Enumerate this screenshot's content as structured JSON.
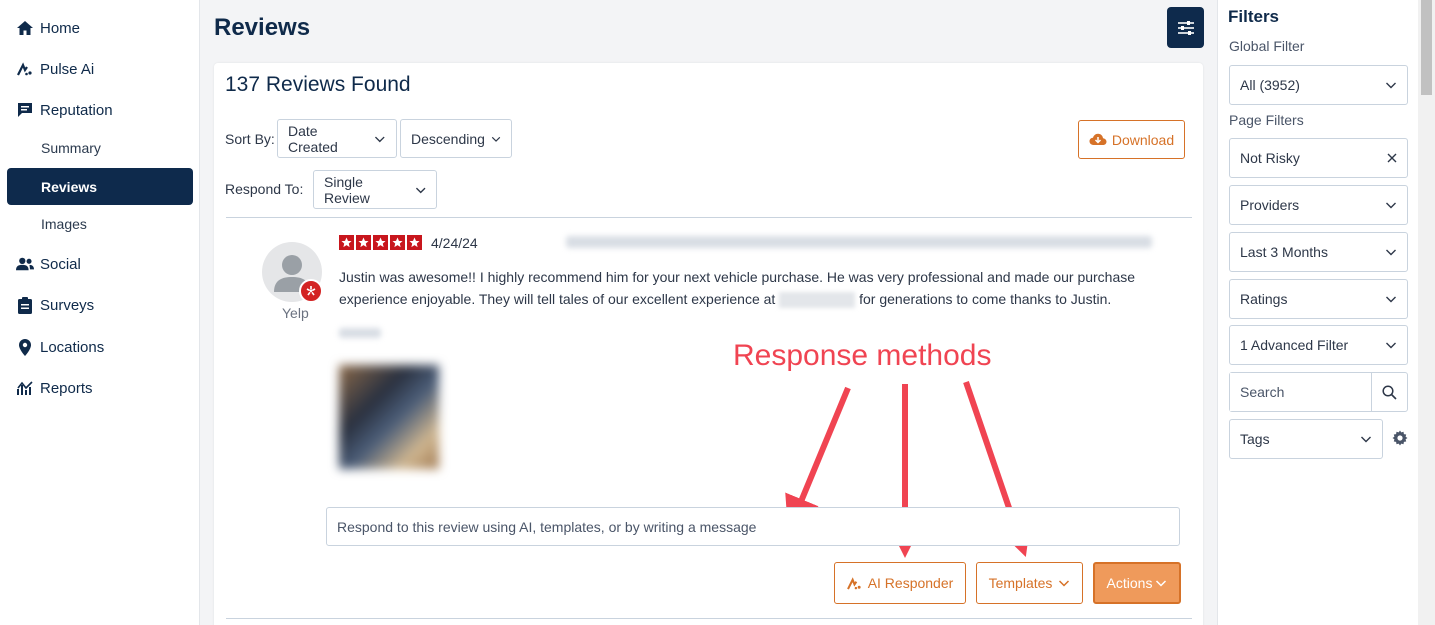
{
  "nav": {
    "home": "Home",
    "pulse_ai": "Pulse Ai",
    "reputation": "Reputation",
    "summary": "Summary",
    "reviews": "Reviews",
    "images": "Images",
    "social": "Social",
    "surveys": "Surveys",
    "locations": "Locations",
    "reports": "Reports"
  },
  "header": {
    "title": "Reviews"
  },
  "results": {
    "count_text": "137 Reviews Found"
  },
  "controls": {
    "sort_by_label": "Sort By:",
    "sort_field": "Date Created",
    "sort_order": "Descending",
    "respond_to_label": "Respond To:",
    "respond_to_value": "Single Review",
    "download_label": "Download"
  },
  "review": {
    "source": "Yelp",
    "rating": 5,
    "date": "4/24/24",
    "text_part1": "Justin was awesome!! I highly recommend him for your next vehicle purchase. He was very professional and made our purchase experience enjoyable. They will tell tales of our excellent experience at",
    "text_part2": "for generations to come thanks to Justin."
  },
  "annotation": {
    "text": "Response methods"
  },
  "response": {
    "placeholder": "Respond to this review using AI, templates, or by writing a message",
    "ai_responder": "AI Responder",
    "templates": "Templates",
    "actions": "Actions"
  },
  "filters": {
    "title": "Filters",
    "global_label": "Global Filter",
    "global_value": "All (3952)",
    "page_label": "Page Filters",
    "not_risky": "Not Risky",
    "providers": "Providers",
    "last_3_months": "Last 3 Months",
    "ratings": "Ratings",
    "advanced": "1 Advanced Filter",
    "search_placeholder": "Search",
    "tags": "Tags"
  },
  "colors": {
    "navy": "#0e2a4c",
    "accent": "#d67228",
    "star_red": "#c8161d",
    "annotation_red": "#f04452"
  }
}
